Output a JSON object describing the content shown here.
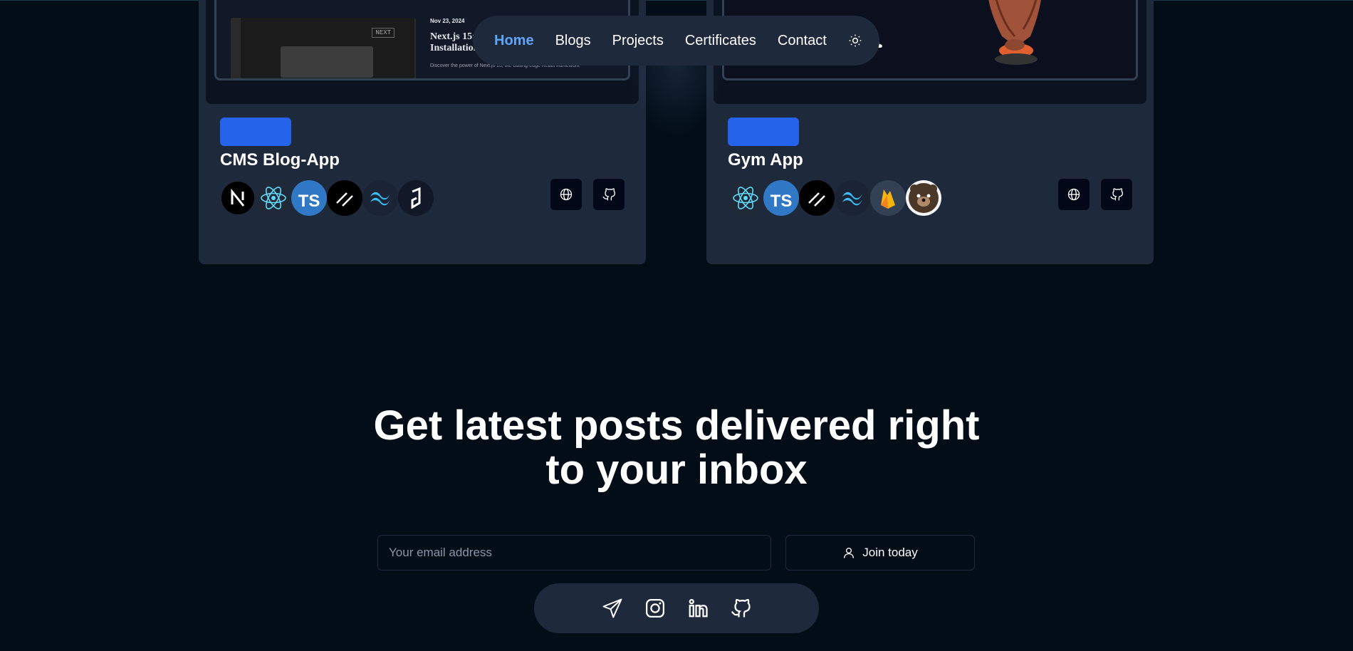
{
  "nav": {
    "items": [
      {
        "label": "Home",
        "active": true
      },
      {
        "label": "Blogs"
      },
      {
        "label": "Projects"
      },
      {
        "label": "Certificates"
      },
      {
        "label": "Contact"
      }
    ],
    "theme_toggle_icon": "sun-icon"
  },
  "projects": [
    {
      "title": "CMS Blog-App",
      "preview": {
        "date": "Nov 23, 2024",
        "title_line1": "Next.js 15: A",
        "title_line2": "Installation,",
        "description": "Discover the power of Next.js 15, the cutting-edge React framework",
        "badge": "NEXT"
      },
      "tech": [
        "nextjs-icon",
        "react-icon",
        "typescript-icon",
        "shadcn-icon",
        "tailwind-icon",
        "hygraph-icon"
      ],
      "tech_ts_label": "TS",
      "actions": [
        "globe-icon",
        "github-icon"
      ]
    },
    {
      "title": "Gym App",
      "tech": [
        "react-icon",
        "typescript-icon",
        "shadcn-icon",
        "tailwind-icon",
        "firebase-icon",
        "zustand-icon"
      ],
      "tech_ts_label": "TS",
      "actions": [
        "globe-icon",
        "github-icon"
      ]
    }
  ],
  "newsletter": {
    "headline_line1": "Get latest posts delivered right",
    "headline_line2": "to your inbox",
    "email_placeholder": "Your email address",
    "join_label": "Join today",
    "join_icon": "user-icon"
  },
  "social": [
    "send-icon",
    "instagram-icon",
    "linkedin-icon",
    "github-icon"
  ],
  "colors": {
    "background": "#020d18",
    "card": "#1e293b",
    "accent": "#2563eb",
    "active_link": "#60a5fa"
  }
}
